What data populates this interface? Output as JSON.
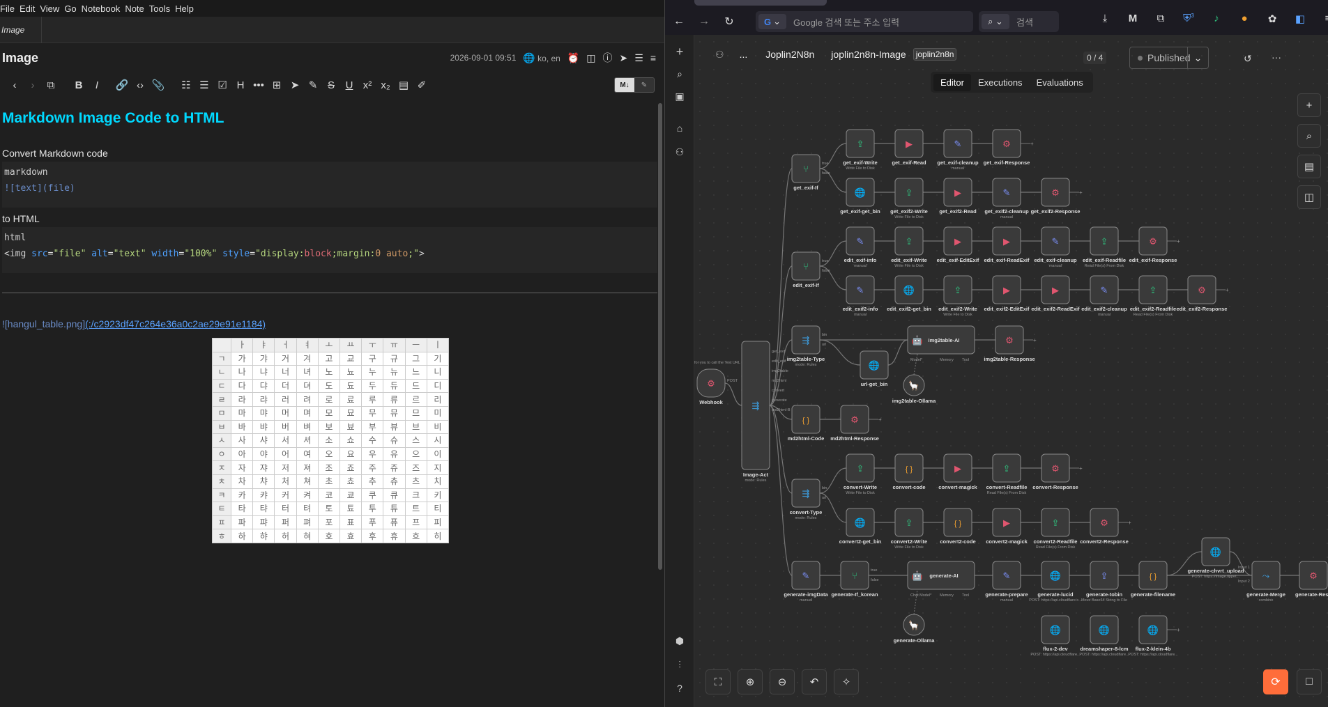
{
  "joplin": {
    "menu": [
      "File",
      "Edit",
      "View",
      "Go",
      "Notebook",
      "Note",
      "Tools",
      "Help"
    ],
    "breadcrumb": "Image",
    "note_title": "Image",
    "meta_date": "2026-09-01 09:51",
    "meta_lang": "ko, en",
    "toolbar_icons": [
      "back-icon",
      "forward-icon",
      "external-edit-icon",
      "bold-icon",
      "italic-icon",
      "link-icon",
      "code-icon",
      "attach-icon",
      "bullet-list-icon",
      "numbered-list-icon",
      "checkbox-list-icon",
      "heading-icon",
      "more-icon",
      "insert-date-icon",
      "send-icon",
      "highlight-icon",
      "strikethrough-icon",
      "underline-icon",
      "superscript-icon",
      "subscript-icon",
      "template-icon",
      "pen-icon"
    ],
    "toolbar_text": {
      "heading": "H",
      "bold": "B",
      "italic": "I",
      "sup": "x²",
      "sub": "x₂"
    },
    "mode_md": "M↓",
    "editor": {
      "h1": "Markdown Image Code to HTML",
      "p1": "Convert Markdown code",
      "code1_lang": "markdown",
      "code1_line": "![text](file)",
      "p2": "to HTML",
      "code2_lang": "html",
      "code2": {
        "open": "<img",
        "a1": "src",
        "v1": "\"file\"",
        "a2": "alt",
        "v2": "\"text\"",
        "a3": "width",
        "v3": "\"100%\"",
        "a4": "style",
        "v4a": "\"display:",
        "v4b": "block",
        "v4c": ";margin:",
        "v4d": "0 auto",
        "v4e": ";\"",
        "close": ">"
      },
      "img_alt": "![hangul_table.png]",
      "img_link": "(:/c2923df47c264e36a0c2ae29e91e1184)"
    },
    "hangul_table": {
      "header": [
        "",
        "ㅏ",
        "ㅑ",
        "ㅓ",
        "ㅕ",
        "ㅗ",
        "ㅛ",
        "ㅜ",
        "ㅠ",
        "ㅡ",
        "ㅣ"
      ],
      "rows": [
        [
          "ㄱ",
          "가",
          "갸",
          "거",
          "겨",
          "고",
          "교",
          "구",
          "규",
          "그",
          "기"
        ],
        [
          "ㄴ",
          "나",
          "냐",
          "너",
          "녀",
          "노",
          "뇨",
          "누",
          "뉴",
          "느",
          "니"
        ],
        [
          "ㄷ",
          "다",
          "댜",
          "더",
          "뎌",
          "도",
          "됴",
          "두",
          "듀",
          "드",
          "디"
        ],
        [
          "ㄹ",
          "라",
          "랴",
          "러",
          "려",
          "로",
          "료",
          "루",
          "류",
          "르",
          "리"
        ],
        [
          "ㅁ",
          "마",
          "먀",
          "머",
          "며",
          "모",
          "묘",
          "무",
          "뮤",
          "므",
          "미"
        ],
        [
          "ㅂ",
          "바",
          "뱌",
          "버",
          "벼",
          "보",
          "뵤",
          "부",
          "뷰",
          "브",
          "비"
        ],
        [
          "ㅅ",
          "사",
          "샤",
          "서",
          "셔",
          "소",
          "쇼",
          "수",
          "슈",
          "스",
          "시"
        ],
        [
          "ㅇ",
          "아",
          "야",
          "어",
          "여",
          "오",
          "요",
          "우",
          "유",
          "으",
          "이"
        ],
        [
          "ㅈ",
          "자",
          "쟈",
          "저",
          "져",
          "조",
          "죠",
          "주",
          "쥬",
          "즈",
          "지"
        ],
        [
          "ㅊ",
          "차",
          "챠",
          "처",
          "쳐",
          "초",
          "쵸",
          "추",
          "츄",
          "츠",
          "치"
        ],
        [
          "ㅋ",
          "카",
          "캬",
          "커",
          "켜",
          "코",
          "쿄",
          "쿠",
          "큐",
          "크",
          "키"
        ],
        [
          "ㅌ",
          "타",
          "탸",
          "터",
          "텨",
          "토",
          "툐",
          "투",
          "튜",
          "트",
          "티"
        ],
        [
          "ㅍ",
          "파",
          "퍄",
          "퍼",
          "펴",
          "포",
          "표",
          "푸",
          "퓨",
          "프",
          "피"
        ],
        [
          "ㅎ",
          "하",
          "햐",
          "허",
          "혀",
          "호",
          "효",
          "후",
          "휴",
          "흐",
          "히"
        ]
      ]
    }
  },
  "browser": {
    "url_placeholder": "Google 검색 또는 주소 입력",
    "search_placeholder": "검색",
    "google_g": "G",
    "account_letter": "M",
    "badge_count": "3"
  },
  "n8n": {
    "breadcrumb": [
      "...",
      "Joplin2N8n",
      "joplin2n8n-Image"
    ],
    "tag": "joplin2n8n",
    "count": "0 / 4",
    "status": "Published",
    "tabs": [
      "Editor",
      "Executions",
      "Evaluations"
    ],
    "active_tab": "Editor",
    "trigger_note": "for you to call the Test URL",
    "webhook_out": "POST",
    "switch_outputs": [
      "get_exif",
      "edit_exif",
      "img2table",
      "md2html",
      "convert",
      "generate",
      "md2html-B"
    ],
    "nodes": [
      {
        "label": "Webhook",
        "sub": "",
        "kind": "webhook",
        "color": "#e0566f"
      },
      {
        "label": "Image-Act",
        "sub": "mode: Rules",
        "kind": "switch",
        "color": "#3d9dde"
      },
      {
        "label": "get_exif-If",
        "sub": "",
        "kind": "if",
        "color": "#2ec27e"
      },
      {
        "label": "get_exif-Write",
        "sub": "Write File to Disk",
        "kind": "file",
        "color": "#2ec27e"
      },
      {
        "label": "get_exif-Read",
        "sub": "",
        "kind": "cmd",
        "color": "#e0566f"
      },
      {
        "label": "get_exif-cleanup",
        "sub": "manual",
        "kind": "edit",
        "color": "#7b8ff7"
      },
      {
        "label": "get_exif-Response",
        "sub": "",
        "kind": "webhook",
        "color": "#e0566f"
      },
      {
        "label": "get_exif-get_bin",
        "sub": "",
        "kind": "http",
        "color": "#7b8ff7"
      },
      {
        "label": "get_exif2-Write",
        "sub": "Write File to Disk",
        "kind": "file",
        "color": "#2ec27e"
      },
      {
        "label": "get_exif2-Read",
        "sub": "",
        "kind": "cmd",
        "color": "#e0566f"
      },
      {
        "label": "get_exif2-cleanup",
        "sub": "manual",
        "kind": "edit",
        "color": "#7b8ff7"
      },
      {
        "label": "get_exif2-Response",
        "sub": "",
        "kind": "webhook",
        "color": "#e0566f"
      },
      {
        "label": "edit_exif-If",
        "sub": "",
        "kind": "if",
        "color": "#2ec27e"
      },
      {
        "label": "edit_exif-info",
        "sub": "manual",
        "kind": "edit",
        "color": "#7b8ff7"
      },
      {
        "label": "edit_exif-Write",
        "sub": "Write File to Disk",
        "kind": "file",
        "color": "#2ec27e"
      },
      {
        "label": "edit_exif-EditExif",
        "sub": "",
        "kind": "cmd",
        "color": "#e0566f"
      },
      {
        "label": "edit_exif-ReadExif",
        "sub": "",
        "kind": "cmd",
        "color": "#e0566f"
      },
      {
        "label": "edit_exif-cleanup",
        "sub": "manual",
        "kind": "edit",
        "color": "#7b8ff7"
      },
      {
        "label": "edit_exif-Readfile",
        "sub": "Read File(s) From Disk",
        "kind": "file",
        "color": "#2ec27e"
      },
      {
        "label": "edit_exif-Response",
        "sub": "",
        "kind": "webhook",
        "color": "#e0566f"
      },
      {
        "label": "edit_exif2-info",
        "sub": "manual",
        "kind": "edit",
        "color": "#7b8ff7"
      },
      {
        "label": "edit_exif2-get_bin",
        "sub": "",
        "kind": "http",
        "color": "#7b8ff7"
      },
      {
        "label": "edit_exif2-Write",
        "sub": "Write File to Disk",
        "kind": "file",
        "color": "#2ec27e"
      },
      {
        "label": "edit_exif2-EditExif",
        "sub": "",
        "kind": "cmd",
        "color": "#e0566f"
      },
      {
        "label": "edit_exif2-ReadExif",
        "sub": "",
        "kind": "cmd",
        "color": "#e0566f"
      },
      {
        "label": "edit_exif2-cleanup",
        "sub": "manual",
        "kind": "edit",
        "color": "#7b8ff7"
      },
      {
        "label": "edit_exif2-Readfile",
        "sub": "Read File(s) From Disk",
        "kind": "file",
        "color": "#2ec27e"
      },
      {
        "label": "edit_exif2-Response",
        "sub": "",
        "kind": "webhook",
        "color": "#e0566f"
      },
      {
        "label": "img2table-Type",
        "sub": "mode: Rules",
        "kind": "switch",
        "color": "#3d9dde"
      },
      {
        "label": "url-get_bin",
        "sub": "",
        "kind": "http",
        "color": "#7b8ff7"
      },
      {
        "label": "img2table-AI",
        "sub": "",
        "kind": "ai",
        "color": "#ddd"
      },
      {
        "label": "img2table-Ollama",
        "sub": "",
        "kind": "ollama",
        "color": "#ddd"
      },
      {
        "label": "img2table-Response",
        "sub": "",
        "kind": "webhook",
        "color": "#e0566f"
      },
      {
        "label": "md2html-Code",
        "sub": "",
        "kind": "code",
        "color": "#f0a030"
      },
      {
        "label": "md2html-Response",
        "sub": "",
        "kind": "webhook",
        "color": "#e0566f"
      },
      {
        "label": "convert-Type",
        "sub": "mode: Rules",
        "kind": "switch",
        "color": "#3d9dde"
      },
      {
        "label": "convert-Write",
        "sub": "Write File to Disk",
        "kind": "file",
        "color": "#2ec27e"
      },
      {
        "label": "convert-code",
        "sub": "",
        "kind": "code",
        "color": "#f0a030"
      },
      {
        "label": "convert-magick",
        "sub": "",
        "kind": "cmd",
        "color": "#e0566f"
      },
      {
        "label": "convert-Readfile",
        "sub": "Read File(s) From Disk",
        "kind": "file",
        "color": "#2ec27e"
      },
      {
        "label": "convert-Response",
        "sub": "",
        "kind": "webhook",
        "color": "#e0566f"
      },
      {
        "label": "convert2-get_bin",
        "sub": "",
        "kind": "http",
        "color": "#7b8ff7"
      },
      {
        "label": "convert2-Write",
        "sub": "Write File to Disk",
        "kind": "file",
        "color": "#2ec27e"
      },
      {
        "label": "convert2-code",
        "sub": "",
        "kind": "code",
        "color": "#f0a030"
      },
      {
        "label": "convert2-magick",
        "sub": "",
        "kind": "cmd",
        "color": "#e0566f"
      },
      {
        "label": "convert2-Readfile",
        "sub": "Read File(s) From Disk",
        "kind": "file",
        "color": "#2ec27e"
      },
      {
        "label": "convert2-Response",
        "sub": "",
        "kind": "webhook",
        "color": "#e0566f"
      },
      {
        "label": "generate-imgData",
        "sub": "manual",
        "kind": "edit",
        "color": "#7b8ff7"
      },
      {
        "label": "generate-If_korean",
        "sub": "",
        "kind": "if",
        "color": "#2ec27e"
      },
      {
        "label": "generate-AI",
        "sub": "",
        "kind": "ai",
        "color": "#ddd"
      },
      {
        "label": "generate-Ollama",
        "sub": "",
        "kind": "ollama",
        "color": "#ddd"
      },
      {
        "label": "generate-prepare",
        "sub": "manual",
        "kind": "edit",
        "color": "#7b8ff7"
      },
      {
        "label": "generate-lucid",
        "sub": "POST: https://api.cloudflare.c...",
        "kind": "http",
        "color": "#7b8ff7"
      },
      {
        "label": "generate-tobin",
        "sub": "Move Base64 String to File",
        "kind": "file",
        "color": "#7b8ff7"
      },
      {
        "label": "generate-filename",
        "sub": "",
        "kind": "code",
        "color": "#f0a030"
      },
      {
        "label": "generate-chvrt_upload",
        "sub": "POST: https://image.tippet...",
        "kind": "http",
        "color": "#7b8ff7"
      },
      {
        "label": "generate-Merge",
        "sub": "combine",
        "kind": "merge",
        "color": "#3d9dde"
      },
      {
        "label": "generate-Resp",
        "sub": "",
        "kind": "webhook",
        "color": "#e0566f"
      },
      {
        "label": "flux-2-dev",
        "sub": "POST: https://api.cloudflare...",
        "kind": "http",
        "color": "#7b8ff7"
      },
      {
        "label": "dreamshaper-8-lcm",
        "sub": "POST: https://api.cloudflare...",
        "kind": "http",
        "color": "#7b8ff7"
      },
      {
        "label": "flux-2-klein-4b",
        "sub": "POST: https://api.cloudflare...",
        "kind": "http",
        "color": "#7b8ff7"
      }
    ],
    "ai_ports": {
      "model": "Model*",
      "chat_model": "Chat Model*",
      "model_plain": "Model",
      "memory": "Memory",
      "tool": "Tool"
    },
    "if_outputs": [
      "true",
      "false"
    ],
    "type_outputs": [
      "bin",
      "url"
    ],
    "merge_inputs": [
      "Input 1",
      "Input 2"
    ]
  }
}
